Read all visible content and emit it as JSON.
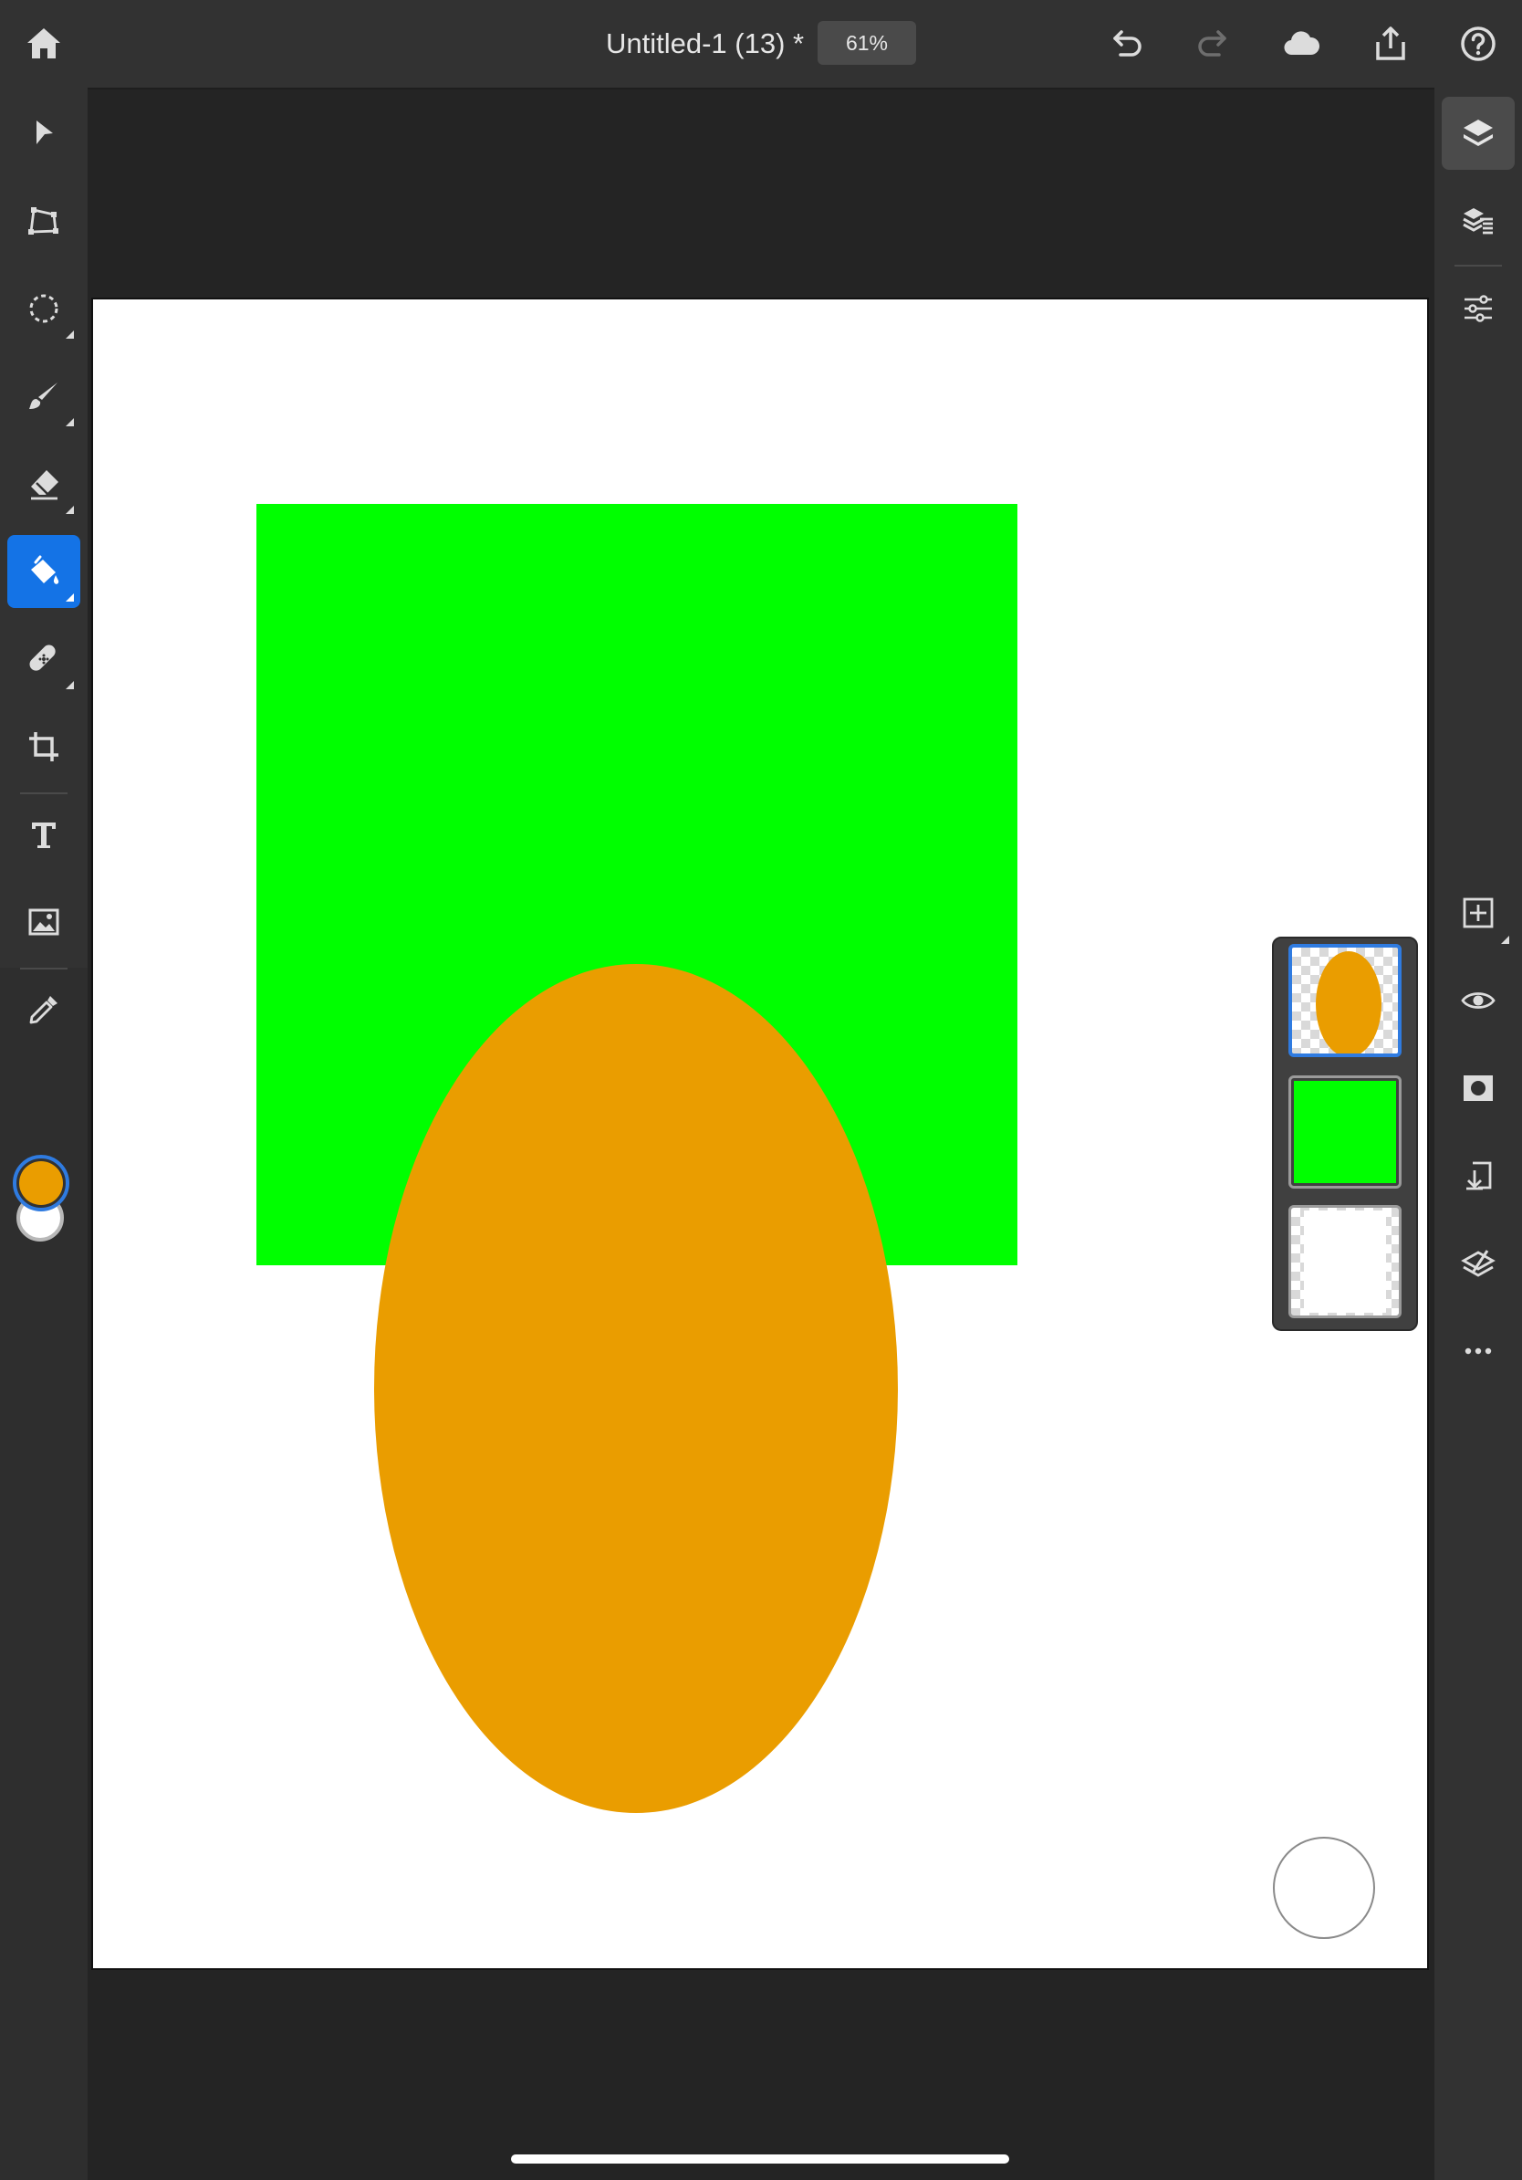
{
  "document": {
    "title": "Untitled-1 (13) *",
    "zoom": "61%"
  },
  "topbar": {
    "left_icons": [
      "home-icon"
    ],
    "right_icons": [
      "undo-icon",
      "redo-icon",
      "cloud-icon",
      "share-icon",
      "help-icon"
    ]
  },
  "left_toolbar": {
    "tools": [
      {
        "name": "select-icon",
        "active": false
      },
      {
        "name": "transform-icon",
        "active": false
      },
      {
        "name": "lasso-select-icon",
        "active": false
      },
      {
        "name": "brush-icon",
        "active": false
      },
      {
        "name": "eraser-icon",
        "active": false
      },
      {
        "name": "fill-bucket-icon",
        "active": true
      },
      {
        "name": "healing-icon",
        "active": false
      },
      {
        "name": "crop-icon",
        "active": false
      },
      {
        "name": "type-icon",
        "active": false
      },
      {
        "name": "place-image-icon",
        "active": false
      },
      {
        "name": "eyedropper-icon",
        "active": false
      }
    ],
    "foreground_color": "#EA9D00",
    "background_color": "#FFFFFF"
  },
  "right_panel": {
    "icons": [
      "layers-icon",
      "layer-properties-icon",
      "adjustments-icon",
      "add-layer-icon",
      "visibility-icon",
      "mask-icon",
      "merge-down-icon",
      "clear-layer-icon",
      "more-icon"
    ]
  },
  "canvas": {
    "background": "#FFFFFF",
    "shapes": [
      {
        "type": "rectangle",
        "color": "#00FF00"
      },
      {
        "type": "ellipse",
        "color": "#EA9D00"
      }
    ]
  },
  "layers": [
    {
      "content": "ellipse",
      "color": "#EA9D00",
      "selected": true
    },
    {
      "content": "fill",
      "color": "#00FF00",
      "selected": false
    },
    {
      "content": "background",
      "color": "#FFFFFF",
      "selected": false
    }
  ]
}
